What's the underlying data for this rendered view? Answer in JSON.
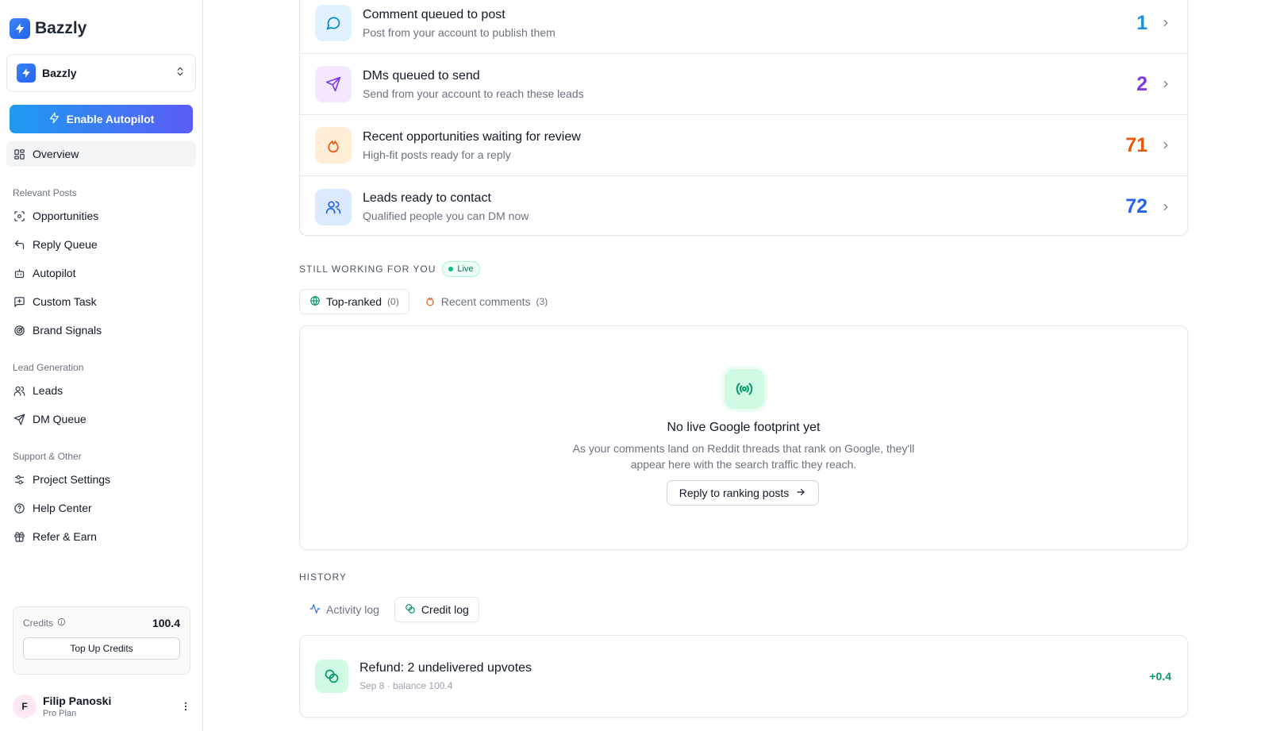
{
  "brand": {
    "name": "Bazzly"
  },
  "project": {
    "name": "Bazzly"
  },
  "autopilot_button": "Enable Autopilot",
  "nav": {
    "overview": "Overview",
    "groups": [
      {
        "label": "Relevant Posts",
        "items": [
          "Opportunities",
          "Reply Queue",
          "Autopilot",
          "Custom Task",
          "Brand Signals"
        ]
      },
      {
        "label": "Lead Generation",
        "items": [
          "Leads",
          "DM Queue"
        ]
      },
      {
        "label": "Support & Other",
        "items": [
          "Project Settings",
          "Help Center",
          "Refer & Earn"
        ]
      }
    ]
  },
  "credits": {
    "label": "Credits",
    "value": "100.4",
    "topup": "Top Up Credits"
  },
  "user": {
    "initial": "F",
    "name": "Filip Panoski",
    "plan": "Pro Plan"
  },
  "queue": [
    {
      "title": "Comment queued to post",
      "subtitle": "Post from your account to publish them",
      "count": "1",
      "color": "#1d8fe0",
      "icon": "message-circle-icon"
    },
    {
      "title": "DMs queued to send",
      "subtitle": "Send from your account to reach these leads",
      "count": "2",
      "color": "#7c3aed",
      "icon": "send-icon"
    },
    {
      "title": "Recent opportunities waiting for review",
      "subtitle": "High-fit posts ready for a reply",
      "count": "71",
      "color": "#ea580c",
      "icon": "flame-icon"
    },
    {
      "title": "Leads ready to contact",
      "subtitle": "Qualified people you can DM now",
      "count": "72",
      "color": "#2563eb",
      "icon": "users-icon"
    }
  ],
  "working": {
    "label": "STILL WORKING FOR YOU",
    "badge": "Live",
    "tabs": [
      {
        "label": "Top-ranked",
        "count": "(0)"
      },
      {
        "label": "Recent comments",
        "count": "(3)"
      }
    ],
    "empty": {
      "title": "No live Google footprint yet",
      "description": "As your comments land on Reddit threads that rank on Google, they'll appear here with the search traffic they reach.",
      "button": "Reply to ranking posts"
    }
  },
  "history": {
    "label": "HISTORY",
    "tabs": [
      "Activity log",
      "Credit log"
    ],
    "entry": {
      "title": "Refund: 2 undelivered upvotes",
      "subtitle": "Sep 8 · balance 100.4",
      "amount": "+0.4"
    }
  }
}
